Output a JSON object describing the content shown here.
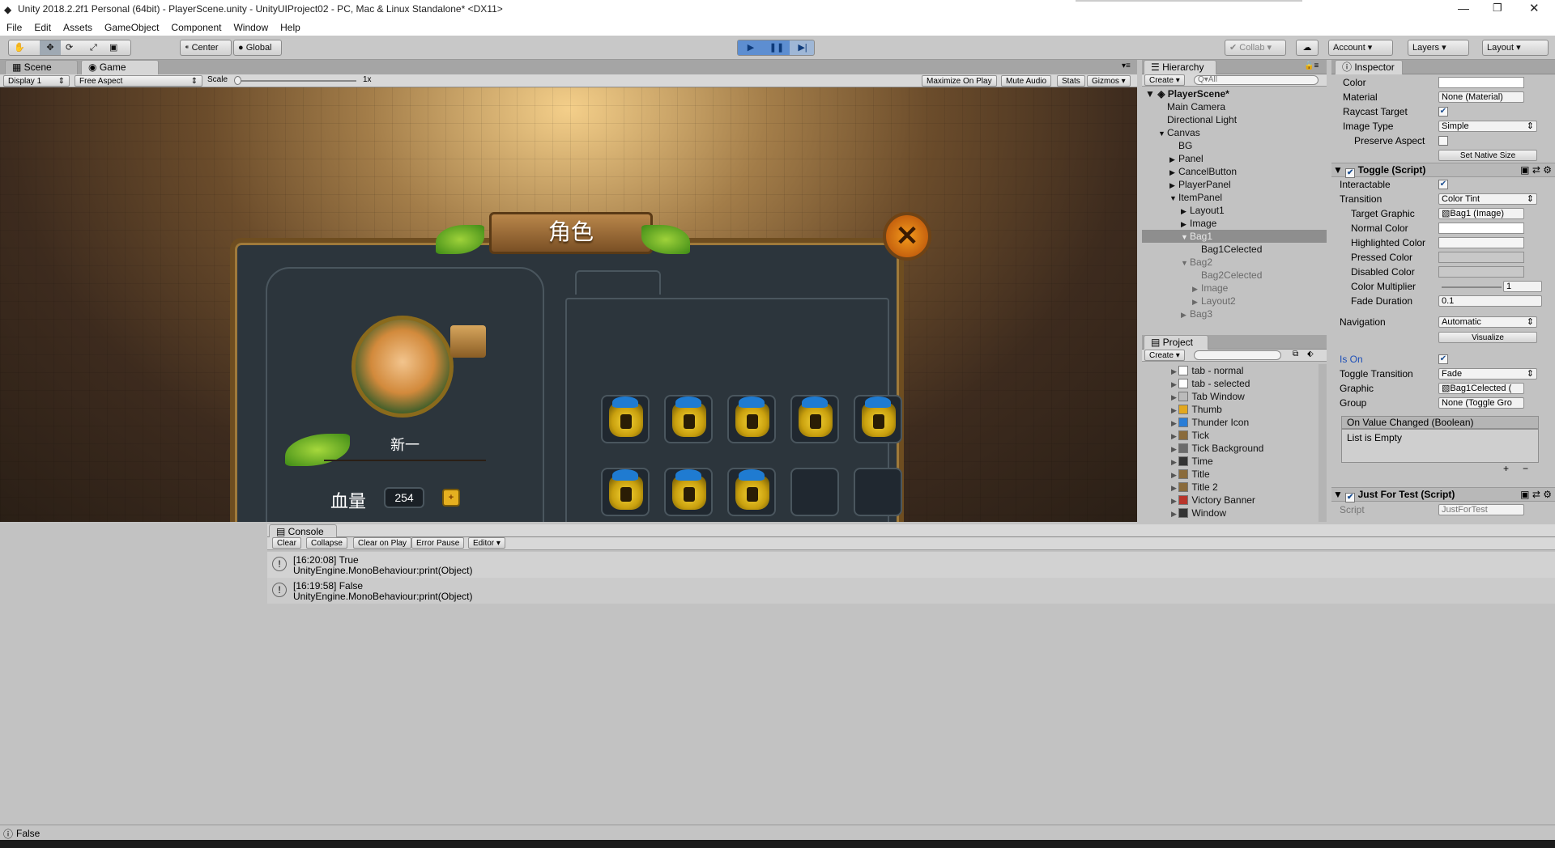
{
  "window": {
    "title": "Unity 2018.2.2f1 Personal (64bit) - PlayerScene.unity - UnityUIProject02 - PC, Mac & Linux Standalone* <DX11>"
  },
  "menu": [
    "File",
    "Edit",
    "Assets",
    "GameObject",
    "Component",
    "Window",
    "Help"
  ],
  "toolbar": {
    "center": "Center",
    "global": "Global",
    "collab": "Collab",
    "account": "Account",
    "layers": "Layers",
    "layout": "Layout"
  },
  "game_view": {
    "tabs": [
      "Scene",
      "Game"
    ],
    "display": "Display 1",
    "aspect": "Free Aspect",
    "scale_label": "Scale",
    "scale_value": "1x",
    "options": [
      "Maximize On Play",
      "Mute Audio",
      "Stats",
      "Gizmos"
    ],
    "ui": {
      "title": "角色",
      "name": "新一",
      "hp_label": "血量",
      "hp_value": "254"
    },
    "inventory": {
      "filled": 8,
      "total": 15
    }
  },
  "hierarchy": {
    "title": "Hierarchy",
    "create": "Create",
    "search": "Q▾All",
    "scene": "PlayerScene*",
    "items": [
      {
        "label": "Main Camera",
        "depth": 1,
        "arrow": ""
      },
      {
        "label": "Directional Light",
        "depth": 1,
        "arrow": ""
      },
      {
        "label": "Canvas",
        "depth": 1,
        "arrow": "▼"
      },
      {
        "label": "BG",
        "depth": 2,
        "arrow": ""
      },
      {
        "label": "Panel",
        "depth": 2,
        "arrow": "▶"
      },
      {
        "label": "CancelButton",
        "depth": 2,
        "arrow": "▶"
      },
      {
        "label": "PlayerPanel",
        "depth": 2,
        "arrow": "▶"
      },
      {
        "label": "ItemPanel",
        "depth": 2,
        "arrow": "▼"
      },
      {
        "label": "Layout1",
        "depth": 3,
        "arrow": "▶"
      },
      {
        "label": "Image",
        "depth": 3,
        "arrow": "▶"
      },
      {
        "label": "Bag1",
        "depth": 3,
        "arrow": "▼",
        "selected": true
      },
      {
        "label": "Bag1Celected",
        "depth": 4,
        "arrow": ""
      },
      {
        "label": "Bag2",
        "depth": 3,
        "arrow": "▼",
        "dim": true
      },
      {
        "label": "Bag2Celected",
        "depth": 4,
        "arrow": "",
        "dim": true
      },
      {
        "label": "Image",
        "depth": 4,
        "arrow": "▶",
        "dim": true
      },
      {
        "label": "Layout2",
        "depth": 4,
        "arrow": "▶",
        "dim": true
      },
      {
        "label": "Bag3",
        "depth": 3,
        "arrow": "▶",
        "dim": true
      }
    ]
  },
  "project": {
    "title": "Project",
    "create": "Create",
    "items": [
      {
        "label": "tab - normal",
        "icon": "#ffffff"
      },
      {
        "label": "tab - selected",
        "icon": "#ffffff"
      },
      {
        "label": "Tab Window",
        "icon": "#bbbbbb"
      },
      {
        "label": "Thumb",
        "icon": "#e3a81e"
      },
      {
        "label": "Thunder Icon",
        "icon": "#2a7dd6"
      },
      {
        "label": "Tick",
        "icon": "#8a6b3b"
      },
      {
        "label": "Tick Background",
        "icon": "#6b6b6b"
      },
      {
        "label": "Time",
        "icon": "#333333"
      },
      {
        "label": "Title",
        "icon": "#8a6b3b"
      },
      {
        "label": "Title 2",
        "icon": "#8a6b3b"
      },
      {
        "label": "Victory Banner",
        "icon": "#b8352b"
      },
      {
        "label": "Window",
        "icon": "#333333"
      }
    ]
  },
  "inspector": {
    "title": "Inspector",
    "image": {
      "color": "Color",
      "material": "Material",
      "material_value": "None (Material)",
      "raycast": "Raycast Target",
      "image_type": "Image Type",
      "image_type_value": "Simple",
      "preserve": "Preserve Aspect",
      "native": "Set Native Size"
    },
    "toggle": {
      "title": "Toggle (Script)",
      "interactable": "Interactable",
      "transition": "Transition",
      "transition_value": "Color Tint",
      "target_graphic": "Target Graphic",
      "target_graphic_value": "Bag1 (Image)",
      "normal": "Normal Color",
      "highlighted": "Highlighted Color",
      "pressed": "Pressed Color",
      "disabled": "Disabled Color",
      "multiplier": "Color Multiplier",
      "multiplier_value": "1",
      "fade": "Fade Duration",
      "fade_value": "0.1",
      "navigation": "Navigation",
      "navigation_value": "Automatic",
      "visualize": "Visualize",
      "is_on": "Is On",
      "toggle_transition": "Toggle Transition",
      "toggle_transition_value": "Fade",
      "graphic": "Graphic",
      "graphic_value": "Bag1Celected (",
      "group": "Group",
      "group_value": "None (Toggle Gro",
      "event": "On Value Changed (Boolean)",
      "event_list": "List is Empty"
    },
    "jft": {
      "title": "Just For Test (Script)",
      "script": "Script",
      "script_value": "JustForTest"
    }
  },
  "console": {
    "title": "Console",
    "buttons": [
      "Clear",
      "Collapse",
      "Clear on Play",
      "Error Pause",
      "Editor"
    ],
    "logs": [
      {
        "line1": "[16:20:08] True",
        "line2": "UnityEngine.MonoBehaviour:print(Object)"
      },
      {
        "line1": "[16:19:58] False",
        "line2": "UnityEngine.MonoBehaviour:print(Object)"
      }
    ]
  },
  "status": {
    "text": "False"
  }
}
